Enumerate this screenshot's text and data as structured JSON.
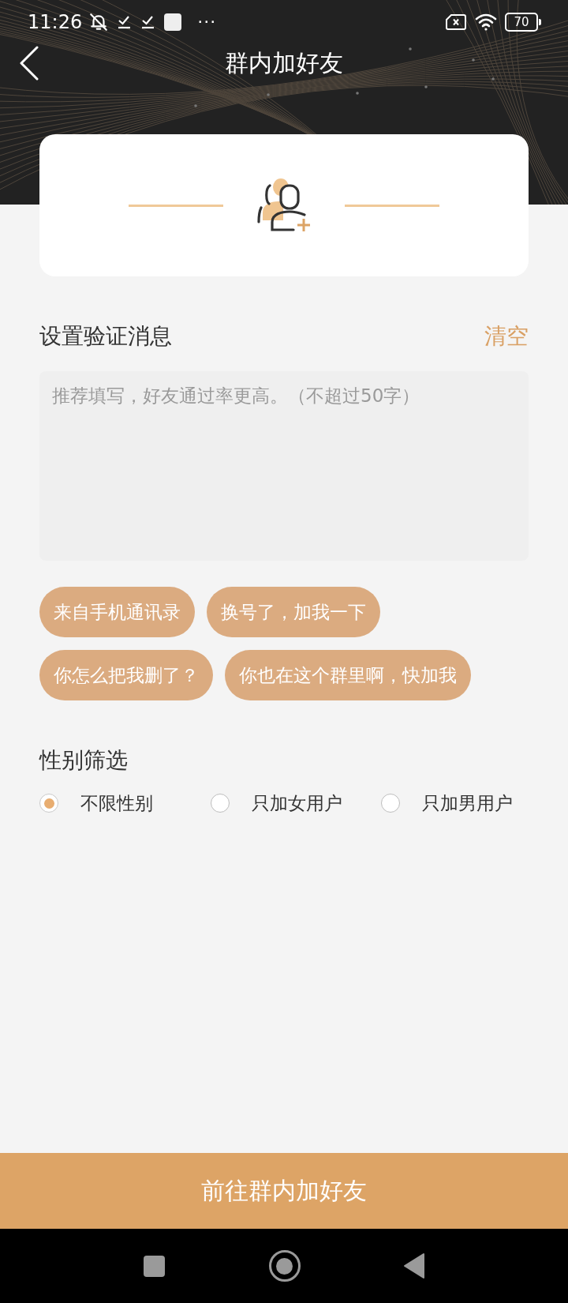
{
  "status_bar": {
    "time": "11:26",
    "overflow": "···",
    "battery": "70"
  },
  "header": {
    "title": "群内加好友"
  },
  "verification": {
    "label": "设置验证消息",
    "clear": "清空",
    "placeholder": "推荐填写，好友通过率更高。（不超过50字）"
  },
  "suggestions": [
    "来自手机通讯录",
    "换号了，加我一下",
    "你怎么把我删了？",
    "你也在这个群里啊，快加我"
  ],
  "gender_filter": {
    "label": "性别筛选",
    "options": [
      {
        "label": "不限性别",
        "selected": true
      },
      {
        "label": "只加女用户",
        "selected": false
      },
      {
        "label": "只加男用户",
        "selected": false
      }
    ]
  },
  "submit_button": {
    "label": "前往群内加好友"
  }
}
